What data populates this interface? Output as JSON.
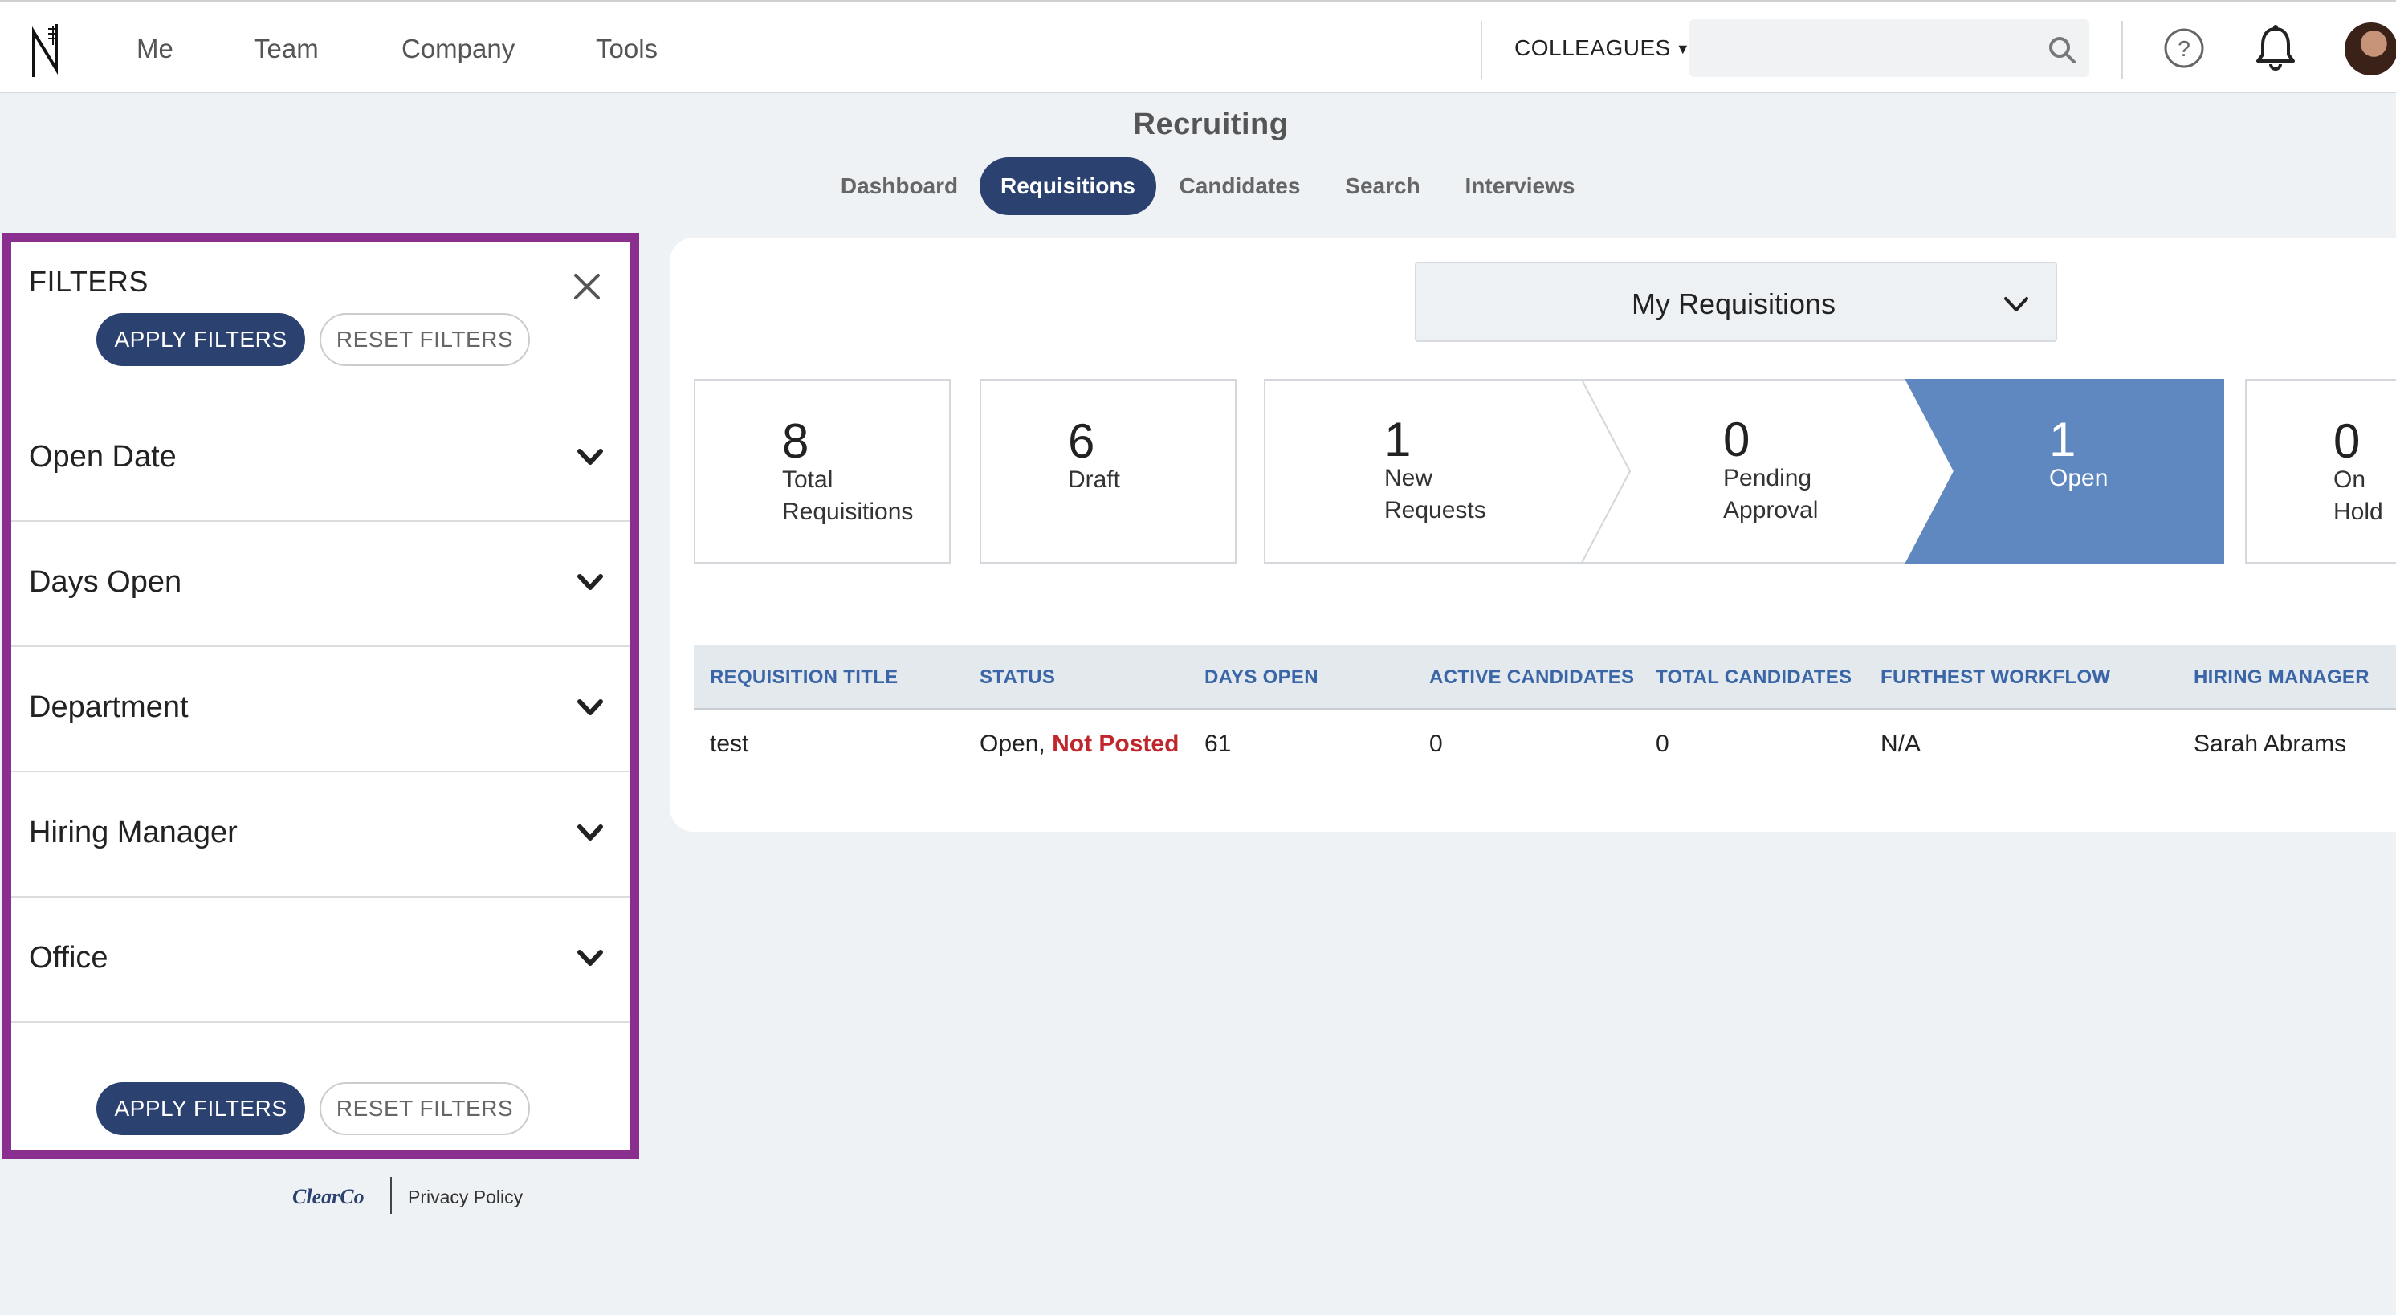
{
  "nav": {
    "items": [
      "Me",
      "Team",
      "Company",
      "Tools"
    ],
    "colleagues_label": "COLLEAGUES",
    "search_placeholder": ""
  },
  "page": {
    "title": "Recruiting",
    "tabs": [
      {
        "label": "Dashboard",
        "active": false
      },
      {
        "label": "Requisitions",
        "active": true
      },
      {
        "label": "Candidates",
        "active": false
      },
      {
        "label": "Search",
        "active": false
      },
      {
        "label": "Interviews",
        "active": false
      }
    ]
  },
  "filters": {
    "title": "FILTERS",
    "apply_label": "APPLY FILTERS",
    "reset_label": "RESET FILTERS",
    "sections": [
      "Open Date",
      "Days Open",
      "Department",
      "Hiring Manager",
      "Office"
    ]
  },
  "footer": {
    "logo_text": "ClearCo",
    "privacy_label": "Privacy Policy"
  },
  "requisitions": {
    "view_select": "My Requisitions",
    "stats": [
      {
        "count": "8",
        "label1": "Total",
        "label2": "Requisitions"
      },
      {
        "count": "6",
        "label1": "Draft",
        "label2": ""
      }
    ],
    "pipeline": [
      {
        "count": "1",
        "label1": "New",
        "label2": "Requests"
      },
      {
        "count": "0",
        "label1": "Pending",
        "label2": "Approval"
      },
      {
        "count": "1",
        "label1": "Open",
        "label2": ""
      }
    ],
    "extra_stat": {
      "count": "0",
      "label1": "On",
      "label2": "Hold"
    },
    "columns": [
      "REQUISITION TITLE",
      "STATUS",
      "DAYS OPEN",
      "ACTIVE CANDIDATES",
      "TOTAL CANDIDATES",
      "FURTHEST WORKFLOW",
      "HIRING MANAGER"
    ],
    "rows": [
      {
        "title": "test",
        "status": "Open,",
        "status_flag": "Not Posted",
        "days_open": "61",
        "active_candidates": "0",
        "total_candidates": "0",
        "furthest_workflow": "N/A",
        "hiring_manager": "Sarah Abrams"
      }
    ]
  },
  "colors": {
    "primary": "#2b4170",
    "highlight": "#8a2e8f",
    "pipeline_active": "#5f87c0",
    "column_header": "#3a66a7",
    "not_posted": "#c0272d"
  }
}
